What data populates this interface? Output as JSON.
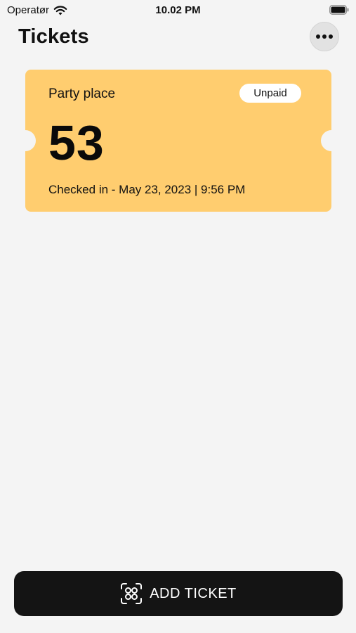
{
  "status_bar": {
    "carrier": "Operatør",
    "time": "10.02 PM"
  },
  "header": {
    "title": "Tickets"
  },
  "ticket": {
    "event_name": "Party place",
    "status": "Unpaid",
    "number": "53",
    "checkin": "Checked in - May 23, 2023 | 9:56 PM"
  },
  "footer": {
    "add_ticket_label": "ADD TICKET"
  },
  "colors": {
    "background": "#f4f4f4",
    "ticket": "#ffcd6f",
    "button": "#141414"
  },
  "icons": [
    "wifi-icon",
    "battery-icon",
    "more-icon",
    "scan-icon"
  ]
}
